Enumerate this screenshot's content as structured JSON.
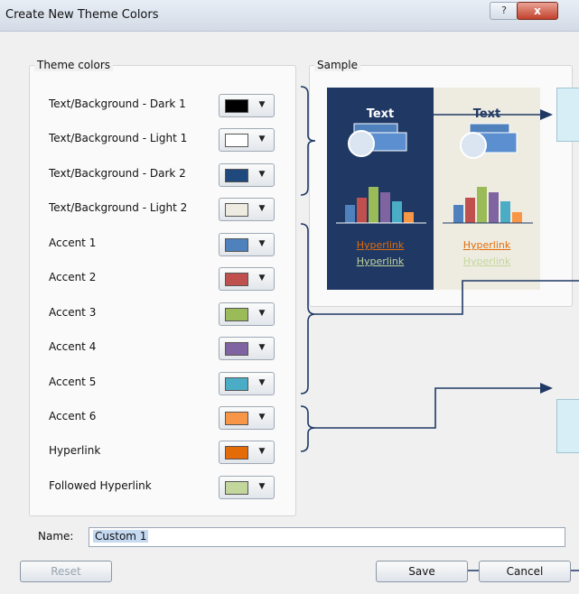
{
  "window": {
    "title": "Create New Theme Colors",
    "help_label": "?",
    "close_label": "x"
  },
  "theme_colors": {
    "group_label": "Theme colors",
    "items": [
      {
        "label": "Text/Background - Dark 1",
        "color": "#000000"
      },
      {
        "label": "Text/Background - Light 1",
        "color": "#ffffff"
      },
      {
        "label": "Text/Background - Dark 2",
        "color": "#1f497d"
      },
      {
        "label": "Text/Background - Light 2",
        "color": "#eeece1"
      },
      {
        "label": "Accent 1",
        "color": "#4f81bd"
      },
      {
        "label": "Accent 2",
        "color": "#c0504d"
      },
      {
        "label": "Accent 3",
        "color": "#9bbb59"
      },
      {
        "label": "Accent 4",
        "color": "#8064a2"
      },
      {
        "label": "Accent 5",
        "color": "#4bacc6"
      },
      {
        "label": "Accent 6",
        "color": "#f79646"
      },
      {
        "label": "Hyperlink",
        "color": "#e36c09"
      },
      {
        "label": "Followed Hyperlink",
        "color": "#c3d69b"
      }
    ],
    "dropdown_glyph": "▼"
  },
  "sample": {
    "group_label": "Sample",
    "dark_text": "Text",
    "light_text": "Text",
    "hyperlink": "Hyperlink",
    "followed_hyperlink": "Hyperlink",
    "dark_bg": "#1f3864",
    "light_bg": "#eeece1",
    "hyperlink_color": "#e36c09",
    "followed_color": "#c3d69b"
  },
  "name": {
    "label": "Name:",
    "value": "Custom 1"
  },
  "buttons": {
    "reset": "Reset",
    "save": "Save",
    "cancel": "Cancel"
  }
}
